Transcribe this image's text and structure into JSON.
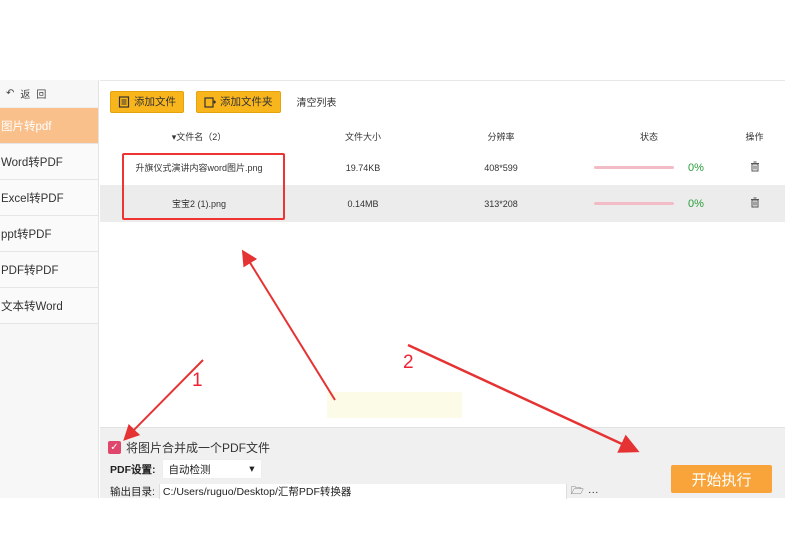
{
  "sidebar": {
    "top_items": [
      "返",
      "回"
    ],
    "items": [
      {
        "label": "图片转pdf",
        "active": true
      },
      {
        "label": "Word转PDF",
        "active": false
      },
      {
        "label": "Excel转PDF",
        "active": false
      },
      {
        "label": "ppt转PDF",
        "active": false
      },
      {
        "label": "PDF转PDF",
        "active": false
      },
      {
        "label": "文本转Word",
        "active": false
      }
    ]
  },
  "toolbar": {
    "add_file": "添加文件",
    "add_folder": "添加文件夹",
    "clear_list": "清空列表"
  },
  "table": {
    "headers": {
      "name": "▾文件名（2）",
      "size": "文件大小",
      "resolution": "分辨率",
      "status": "状态",
      "action": "操作"
    },
    "rows": [
      {
        "name": "升旗仪式演讲内容word图片.png",
        "size": "19.74KB",
        "resolution": "408*599",
        "progress": "0%"
      },
      {
        "name": "宝宝2 (1).png",
        "size": "0.14MB",
        "resolution": "313*208",
        "progress": "0%"
      }
    ]
  },
  "bottom": {
    "merge_label": "将图片合并成一个PDF文件",
    "pdf_setting_label": "PDF设置:",
    "pdf_setting_value": "自动检测",
    "output_label": "输出目录:",
    "output_path": "C:/Users/ruguo/Desktop/汇帮PDF转换器",
    "more": "···",
    "start_button": "开始执行"
  },
  "annotations": {
    "step1": "1",
    "step2": "2",
    "color": "#e53333"
  }
}
